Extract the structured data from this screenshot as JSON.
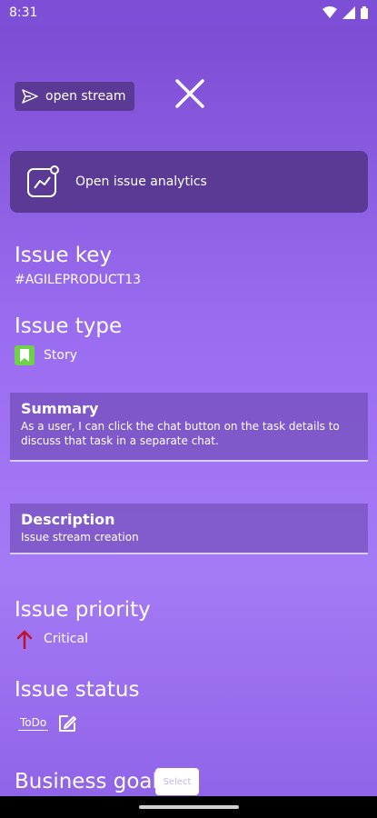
{
  "status_bar": {
    "time": "8:31"
  },
  "top": {
    "open_stream_label": "open stream"
  },
  "analytics": {
    "label": "Open issue analytics"
  },
  "issue_key": {
    "label": "Issue key",
    "value": "#AGILEPRODUCT13"
  },
  "issue_type": {
    "label": "Issue type",
    "value": "Story",
    "icon_color": "#6fd04a"
  },
  "summary": {
    "title": "Summary",
    "body": "As a user, I can click the chat button on the task details to discuss that task in a separate chat."
  },
  "description": {
    "title": "Description",
    "body": "Issue stream creation"
  },
  "issue_priority": {
    "label": "Issue priority",
    "value": "Critical",
    "icon_color": "#c0112b"
  },
  "issue_status": {
    "label": "Issue status",
    "value": "ToDo"
  },
  "business_goal": {
    "label": "Business goal",
    "select_label": "Select"
  }
}
